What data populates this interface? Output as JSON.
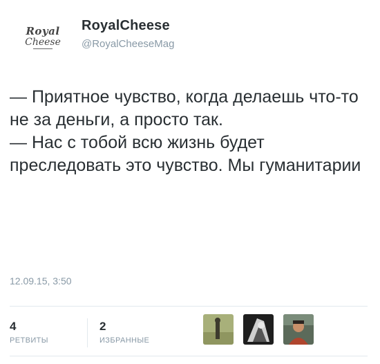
{
  "account": {
    "display_name": "RoyalCheese",
    "handle": "@RoyalCheeseMag",
    "avatar_text": [
      "Royal",
      "Cheese"
    ]
  },
  "tweet": {
    "lines": [
      "— Приятное чувство, когда делаешь что-то не за деньги, а просто так.",
      "— Нас с тобой всю жизнь будет преследовать это чувство. Мы гуманитарии"
    ],
    "timestamp": "12.09.15, 3:50"
  },
  "stats": {
    "retweets": {
      "count": "4",
      "label": "РЕТВИТЫ"
    },
    "favorites": {
      "count": "2",
      "label": "ИЗБРАННЫЕ"
    }
  },
  "favorited_by": [
    {
      "icon": "user-avatar-1"
    },
    {
      "icon": "user-avatar-2"
    },
    {
      "icon": "user-avatar-3"
    }
  ]
}
